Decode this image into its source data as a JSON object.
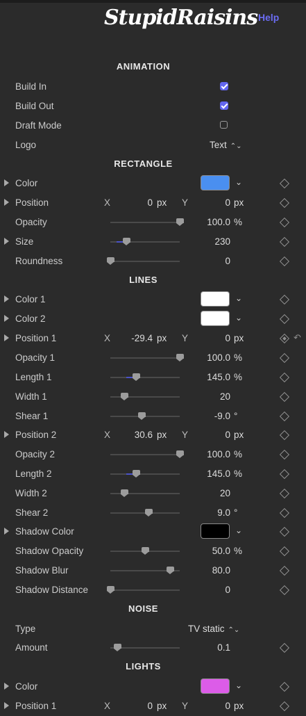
{
  "header": {
    "logo_text": "StupidRaisins",
    "help": "Help"
  },
  "sections": [
    {
      "title": "ANIMATION"
    },
    {
      "title": "RECTANGLE"
    },
    {
      "title": "LINES"
    },
    {
      "title": "NOISE"
    },
    {
      "title": "LIGHTS"
    }
  ],
  "animation": {
    "build_in": {
      "label": "Build In",
      "checked": true
    },
    "build_out": {
      "label": "Build Out",
      "checked": true
    },
    "draft_mode": {
      "label": "Draft Mode",
      "checked": false
    },
    "logo": {
      "label": "Logo",
      "value": "Text"
    }
  },
  "rectangle": {
    "color": {
      "label": "Color",
      "swatch": "#4a8ff0"
    },
    "position": {
      "label": "Position",
      "x_axis": "X",
      "x": "0",
      "x_unit": "px",
      "y_axis": "Y",
      "y": "0",
      "y_unit": "px"
    },
    "opacity": {
      "label": "Opacity",
      "value": "100.0",
      "unit": "%",
      "level": 1.0
    },
    "size": {
      "label": "Size",
      "value": "230",
      "level": 0.23
    },
    "roundness": {
      "label": "Roundness",
      "value": "0",
      "level": 0.0
    }
  },
  "lines": {
    "color1": {
      "label": "Color 1",
      "swatch": "#ffffff"
    },
    "color2": {
      "label": "Color 2",
      "swatch": "#ffffff"
    },
    "position1": {
      "label": "Position 1",
      "x_axis": "X",
      "x": "-29.4",
      "x_unit": "px",
      "y_axis": "Y",
      "y": "0",
      "y_unit": "px"
    },
    "opacity1": {
      "label": "Opacity 1",
      "value": "100.0",
      "unit": "%",
      "level": 1.0
    },
    "length1": {
      "label": "Length 1",
      "value": "145.0",
      "unit": "%",
      "level": 0.37
    },
    "width1": {
      "label": "Width 1",
      "value": "20",
      "level": 0.2
    },
    "shear1": {
      "label": "Shear 1",
      "value": "-9.0",
      "unit": "°",
      "level": 0.45
    },
    "position2": {
      "label": "Position 2",
      "x_axis": "X",
      "x": "30.6",
      "x_unit": "px",
      "y_axis": "Y",
      "y": "0",
      "y_unit": "px"
    },
    "opacity2": {
      "label": "Opacity 2",
      "value": "100.0",
      "unit": "%",
      "level": 1.0
    },
    "length2": {
      "label": "Length 2",
      "value": "145.0",
      "unit": "%",
      "level": 0.37
    },
    "width2": {
      "label": "Width 2",
      "value": "20",
      "level": 0.2
    },
    "shear2": {
      "label": "Shear 2",
      "value": "9.0",
      "unit": "°",
      "level": 0.55
    },
    "shadow_color": {
      "label": "Shadow Color",
      "swatch": "#000000"
    },
    "shadow_opacity": {
      "label": "Shadow Opacity",
      "value": "50.0",
      "unit": "%",
      "level": 0.5
    },
    "shadow_blur": {
      "label": "Shadow Blur",
      "value": "80.0",
      "level": 0.86
    },
    "shadow_distance": {
      "label": "Shadow Distance",
      "value": "0",
      "level": 0.0
    }
  },
  "noise": {
    "type": {
      "label": "Type",
      "value": "TV static"
    },
    "amount": {
      "label": "Amount",
      "value": "0.1",
      "level": 0.1
    }
  },
  "lights": {
    "color": {
      "label": "Color",
      "swatch": "#dc5ce8"
    },
    "position1": {
      "label": "Position 1",
      "x_axis": "X",
      "x": "0",
      "x_unit": "px",
      "y_axis": "Y",
      "y": "0",
      "y_unit": "px"
    }
  },
  "icons": {
    "popup_arrows": "⌃⌄",
    "chevron": "⌄",
    "reset": "↶"
  }
}
